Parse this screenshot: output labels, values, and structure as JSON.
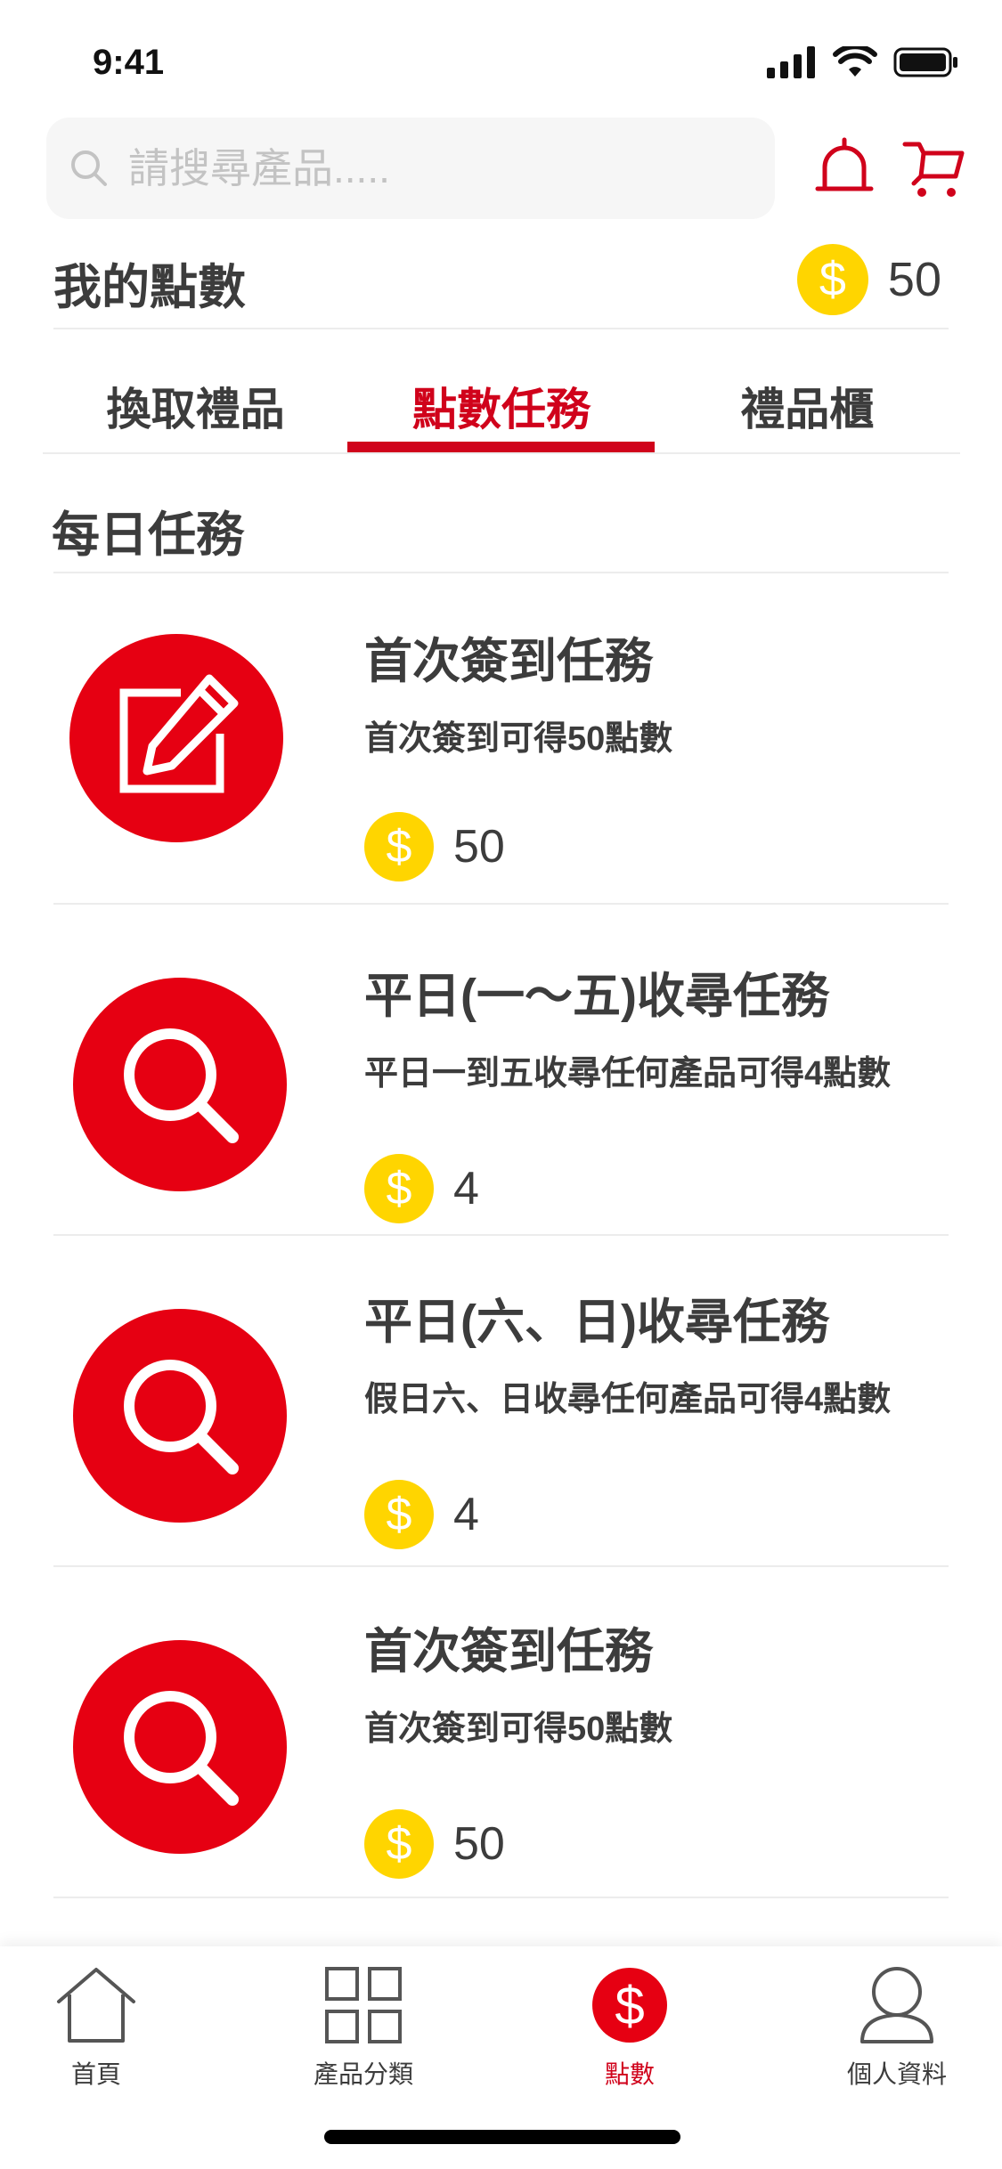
{
  "status_bar": {
    "time": "9:41"
  },
  "search": {
    "placeholder": "請搜尋產品....."
  },
  "points": {
    "title": "我的點數",
    "balance": "50",
    "currency_symbol": "$"
  },
  "tabs": [
    {
      "label": "換取禮品",
      "active": false
    },
    {
      "label": "點數任務",
      "active": true
    },
    {
      "label": "禮品櫃",
      "active": false
    }
  ],
  "section": {
    "title": "每日任務"
  },
  "tasks": [
    {
      "title": "首次簽到任務",
      "description": "首次簽到可得50點數",
      "reward": "50",
      "icon": "edit-icon"
    },
    {
      "title": "平日(一～五)收尋任務",
      "description": "平日一到五收尋任何產品可得4點數",
      "reward": "4",
      "icon": "search-icon"
    },
    {
      "title": "平日(六、日)收尋任務",
      "description": "假日六、日收尋任何產品可得4點數",
      "reward": "4",
      "icon": "search-icon"
    },
    {
      "title": "首次簽到任務",
      "description": "首次簽到可得50點數",
      "reward": "50",
      "icon": "search-icon"
    }
  ],
  "bottom_nav": [
    {
      "label": "首頁",
      "icon": "home-icon",
      "active": false
    },
    {
      "label": "產品分類",
      "icon": "grid-icon",
      "active": false
    },
    {
      "label": "點數",
      "icon": "dollar-icon",
      "active": true
    },
    {
      "label": "個人資料",
      "icon": "user-icon",
      "active": false
    }
  ],
  "colors": {
    "accent": "#d0021b",
    "icon_red": "#e60012",
    "coin": "#ffd500",
    "text": "#3c3c3c"
  }
}
